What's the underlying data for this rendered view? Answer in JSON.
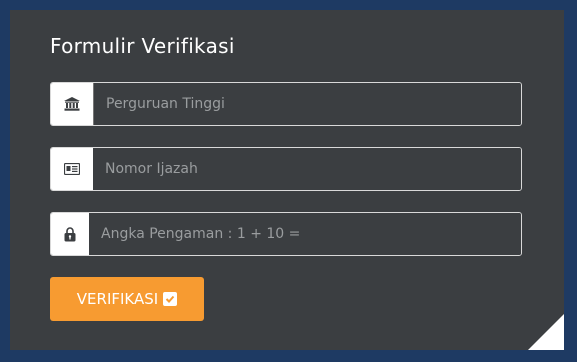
{
  "form": {
    "title": "Formulir Verifikasi",
    "fields": [
      {
        "icon": "bank-icon",
        "placeholder": "Perguruan Tinggi",
        "value": ""
      },
      {
        "icon": "id-card-icon",
        "placeholder": "Nomor Ijazah",
        "value": ""
      },
      {
        "icon": "lock-icon",
        "placeholder": "Angka Pengaman : 1 + 10 =",
        "value": ""
      }
    ],
    "submit_label": "VERIFIKASI",
    "submit_icon": "check-square-icon"
  },
  "colors": {
    "background": "#1e3a63",
    "card": "#3b3e41",
    "accent": "#f79b31",
    "text": "#ffffff"
  }
}
